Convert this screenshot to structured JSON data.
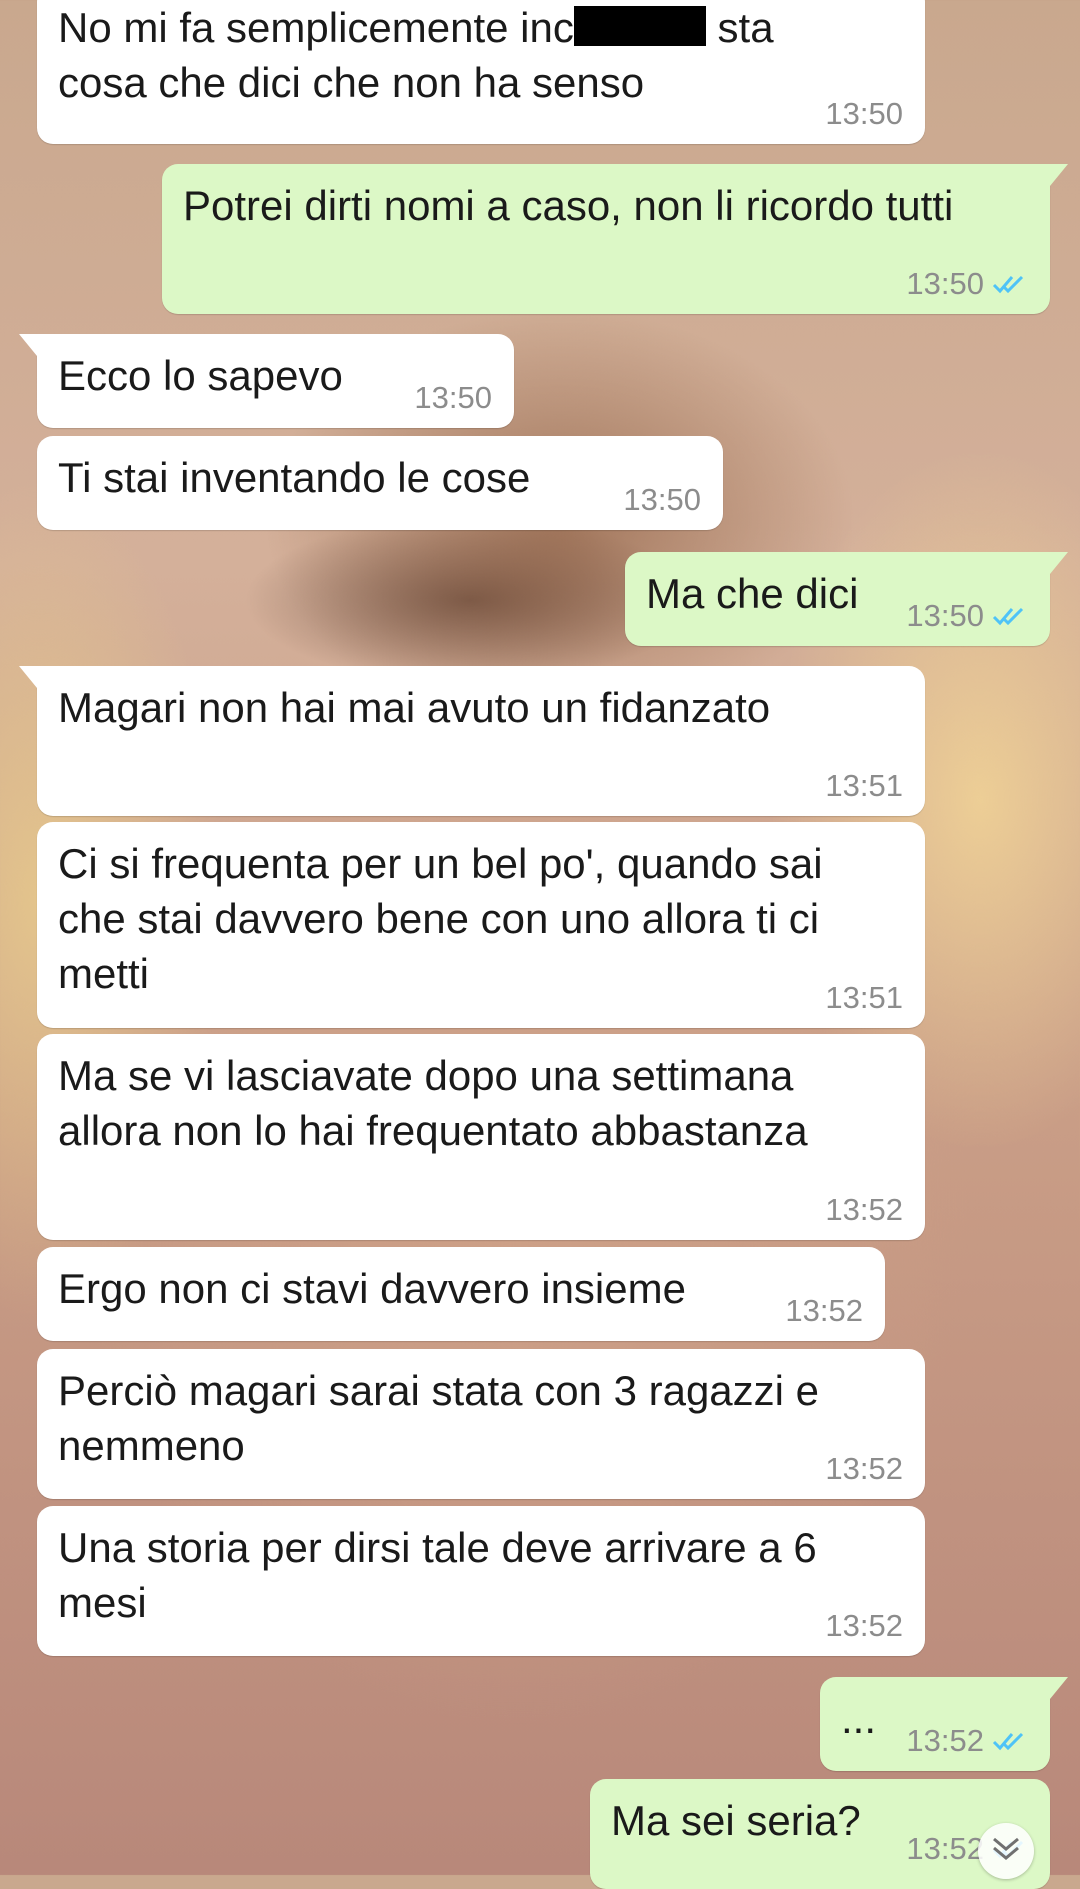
{
  "messages": [
    {
      "direction": "in",
      "lines": [
        "No mi fa semplicemente inc",
        " sta",
        "cosa che dici che non ha senso"
      ],
      "time": "13:50"
    },
    {
      "direction": "out",
      "text": "Potrei dirti nomi a caso, non li ricordo tutti",
      "time": "13:50",
      "status": "read"
    },
    {
      "direction": "in",
      "text": "Ecco lo sapevo",
      "time": "13:50"
    },
    {
      "direction": "in",
      "text": "Ti stai inventando le cose",
      "time": "13:50"
    },
    {
      "direction": "out",
      "text": "Ma che dici",
      "time": "13:50",
      "status": "read"
    },
    {
      "direction": "in",
      "text": "Magari non hai mai avuto un fidanzato",
      "time": "13:51"
    },
    {
      "direction": "in",
      "text": "Ci si frequenta per un bel po', quando sai\nche stai davvero bene con uno allora ti ci\nmetti",
      "time": "13:51"
    },
    {
      "direction": "in",
      "text": "Ma se vi lasciavate dopo una settimana\nallora non lo hai frequentato abbastanza",
      "time": "13:52"
    },
    {
      "direction": "in",
      "text": "Ergo non ci stavi davvero insieme",
      "time": "13:52"
    },
    {
      "direction": "in",
      "text": "Perciò magari sarai stata con 3 ragazzi e\nnemmeno",
      "time": "13:52"
    },
    {
      "direction": "in",
      "text": "Una storia per dirsi tale deve arrivare a 6\nmesi",
      "time": "13:52"
    },
    {
      "direction": "out",
      "text": "...",
      "time": "13:52",
      "status": "read"
    },
    {
      "direction": "out",
      "text": "Ma sei seria?",
      "time": "13:52",
      "status": "read"
    }
  ],
  "icons": {
    "read_check": "double-check-icon",
    "scroll_down": "chevron-double-down-icon"
  },
  "colors": {
    "incoming_bubble": "#ffffff",
    "outgoing_bubble": "#dcf8c6",
    "read_check": "#4fc3f7",
    "timestamp": "#8c8c8c"
  }
}
